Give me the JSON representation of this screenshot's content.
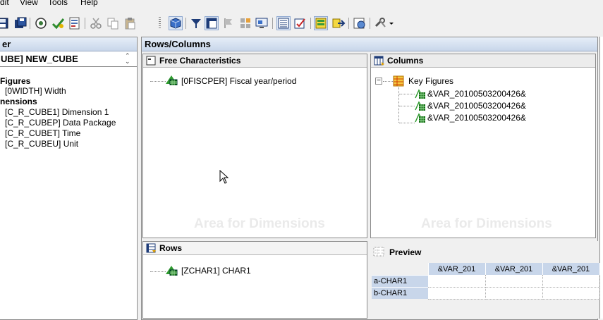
{
  "menu": [
    "dit",
    "View",
    "Tools",
    "Help"
  ],
  "toolbar": {
    "icons": [
      "save-icon",
      "save-all-icon",
      "check-icon",
      "activate-icon",
      "properties-icon",
      "cut-icon",
      "copy-icon",
      "paste-icon",
      "cube-icon",
      "filter-icon",
      "rows-columns-icon",
      "exceptions-icon",
      "conditions-icon",
      "display-icon",
      "table-view-icon",
      "check-query-icon",
      "cells-icon",
      "export-icon",
      "web-icon",
      "tools-dropdown-icon"
    ]
  },
  "left_panel": {
    "title": "er",
    "cube": "UBE] NEW_CUBE",
    "tree": [
      {
        "label": "Figures",
        "bold": true,
        "indent": 0
      },
      {
        "label": "[0WIDTH] Width",
        "bold": false,
        "indent": 1
      },
      {
        "label": "nensions",
        "bold": true,
        "indent": 0
      },
      {
        "label": "[C_R_CUBE1] Dimension 1",
        "bold": false,
        "indent": 1
      },
      {
        "label": "[C_R_CUBEP] Data Package",
        "bold": false,
        "indent": 1
      },
      {
        "label": "[C_R_CUBET] Time",
        "bold": false,
        "indent": 1
      },
      {
        "label": "[C_R_CUBEU] Unit",
        "bold": false,
        "indent": 1
      }
    ]
  },
  "main": {
    "title": "Rows/Columns",
    "free_characteristics": {
      "title": "Free Characteristics",
      "items": [
        "[0FISCPER] Fiscal year/period"
      ],
      "watermark": "Area for Dimensions"
    },
    "columns": {
      "title": "Columns",
      "root": "Key Figures",
      "items": [
        "&VAR_20100503200426&",
        "&VAR_20100503200426&",
        "&VAR_20100503200426&"
      ],
      "watermark": "Area for Dimensions"
    },
    "rows": {
      "title": "Rows",
      "items": [
        "[ZCHAR1] CHAR1"
      ]
    },
    "preview": {
      "title": "Preview",
      "col_headers": [
        "&VAR_201",
        "&VAR_201",
        "&VAR_201"
      ],
      "row_headers": [
        "a-CHAR1",
        "b-CHAR1"
      ]
    }
  }
}
